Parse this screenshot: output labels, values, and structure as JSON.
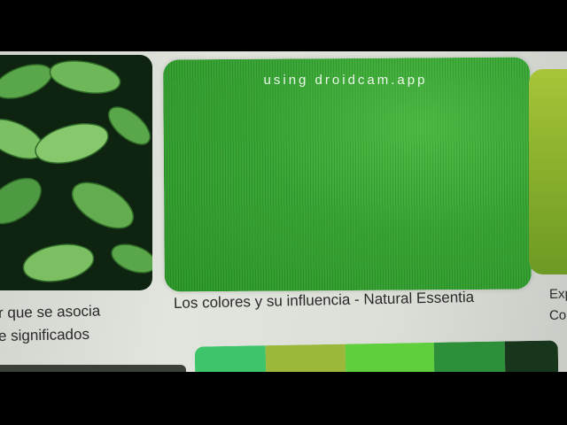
{
  "watermark": "using droidcam.app",
  "cards": [
    {
      "caption_lines": [
        "r que se asocia",
        "e significados"
      ]
    },
    {
      "caption_lines": [
        "Los colores y su influencia - Natural Essentia"
      ]
    },
    {
      "caption_lines": [
        "Exp",
        "Co"
      ]
    }
  ],
  "bottom_swatches": [
    "#3ec46a",
    "#9bb83a",
    "#5fcf3e",
    "#2e8f3a",
    "#17361c"
  ]
}
